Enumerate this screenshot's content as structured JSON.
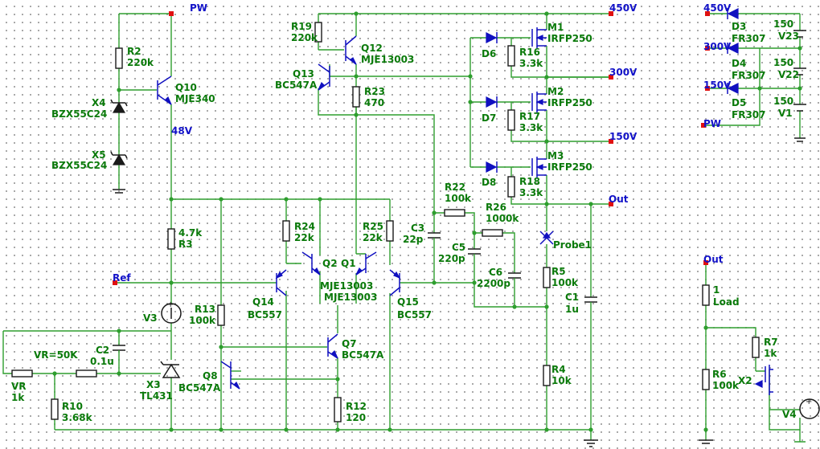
{
  "nets": {
    "pw": "PW",
    "v48": "48V",
    "v450": "450V",
    "v300": "300V",
    "v150": "150V",
    "out": "Out",
    "ref": "Ref",
    "right_450": "450V",
    "right_300": "300V",
    "right_150": "150V",
    "right_pw": "PW",
    "load_out": "Out"
  },
  "parts": {
    "r2": {
      "ref": "R2",
      "val": "220k"
    },
    "q10": {
      "ref": "Q10",
      "val": "MJE340"
    },
    "x4": {
      "ref": "X4",
      "val": "BZX55C24"
    },
    "x5": {
      "ref": "X5",
      "val": "BZX55C24"
    },
    "r3": {
      "ref": "R3",
      "val": "4.7k"
    },
    "v3": {
      "ref": "V3"
    },
    "r13": {
      "ref": "R13",
      "val": "100k"
    },
    "vr": {
      "ref": "VR",
      "val": "1k",
      "param": "VR=50K"
    },
    "c2": {
      "ref": "C2",
      "val": "0.1u"
    },
    "x3": {
      "ref": "X3",
      "val": "TL431"
    },
    "r10": {
      "ref": "R10",
      "val": "3.68k"
    },
    "q8": {
      "ref": "Q8",
      "val": "BC547A"
    },
    "q14": {
      "ref": "Q14",
      "val": "BC557"
    },
    "r24": {
      "ref": "R24",
      "val": "22k"
    },
    "q2": {
      "ref": "Q2"
    },
    "q1": {
      "ref": "Q1"
    },
    "q2q1_model_a": "MJE13003",
    "q2q1_model_b": "MJE13003",
    "r25": {
      "ref": "R25",
      "val": "22k"
    },
    "q15": {
      "ref": "Q15",
      "val": "BC557"
    },
    "q7": {
      "ref": "Q7",
      "val": "BC547A"
    },
    "r12": {
      "ref": "R12",
      "val": "120"
    },
    "r19": {
      "ref": "R19",
      "val": "220k"
    },
    "q12": {
      "ref": "Q12",
      "val": "MJE13003"
    },
    "q13": {
      "ref": "Q13",
      "val": "BC547A"
    },
    "r23": {
      "ref": "R23",
      "val": "470"
    },
    "c3": {
      "ref": "C3",
      "val": "22p"
    },
    "r22": {
      "ref": "R22",
      "val": "100k"
    },
    "r26": {
      "ref": "R26",
      "val": "1000k"
    },
    "c5": {
      "ref": "C5",
      "val": "220p"
    },
    "c6": {
      "ref": "C6",
      "val": "2200p"
    },
    "d6": {
      "ref": "D6"
    },
    "d7": {
      "ref": "D7"
    },
    "d8": {
      "ref": "D8"
    },
    "m1": {
      "ref": "M1",
      "val": "IRFP250"
    },
    "m2": {
      "ref": "M2",
      "val": "IRFP250"
    },
    "m3": {
      "ref": "M3",
      "val": "IRFP250"
    },
    "r16": {
      "ref": "R16",
      "val": "3.3k"
    },
    "r17": {
      "ref": "R17",
      "val": "3.3k"
    },
    "r18": {
      "ref": "R18",
      "val": "3.3k"
    },
    "probe": {
      "ref": "Probe1"
    },
    "r5": {
      "ref": "R5",
      "val": "100k"
    },
    "r4": {
      "ref": "R4",
      "val": "10k"
    },
    "c1": {
      "ref": "C1",
      "val": "1u"
    },
    "d3": {
      "ref": "D3",
      "val": "FR307"
    },
    "d4": {
      "ref": "D4",
      "val": "FR307"
    },
    "d5": {
      "ref": "D5",
      "val": "FR307"
    },
    "v23": {
      "ref": "V23",
      "val": "150"
    },
    "v22": {
      "ref": "V22",
      "val": "150"
    },
    "v1": {
      "ref": "V1",
      "val": "150"
    },
    "load": {
      "ref": "Load",
      "val": "1"
    },
    "r7": {
      "ref": "R7",
      "val": "1k"
    },
    "r6": {
      "ref": "R6",
      "val": "100k"
    },
    "x2": {
      "ref": "X2"
    },
    "v4": {
      "ref": "V4"
    }
  },
  "colors": {
    "wire": "#2e9e2e",
    "label": "#0a7a0a",
    "net": "#1212c8",
    "port": "#e01010"
  }
}
